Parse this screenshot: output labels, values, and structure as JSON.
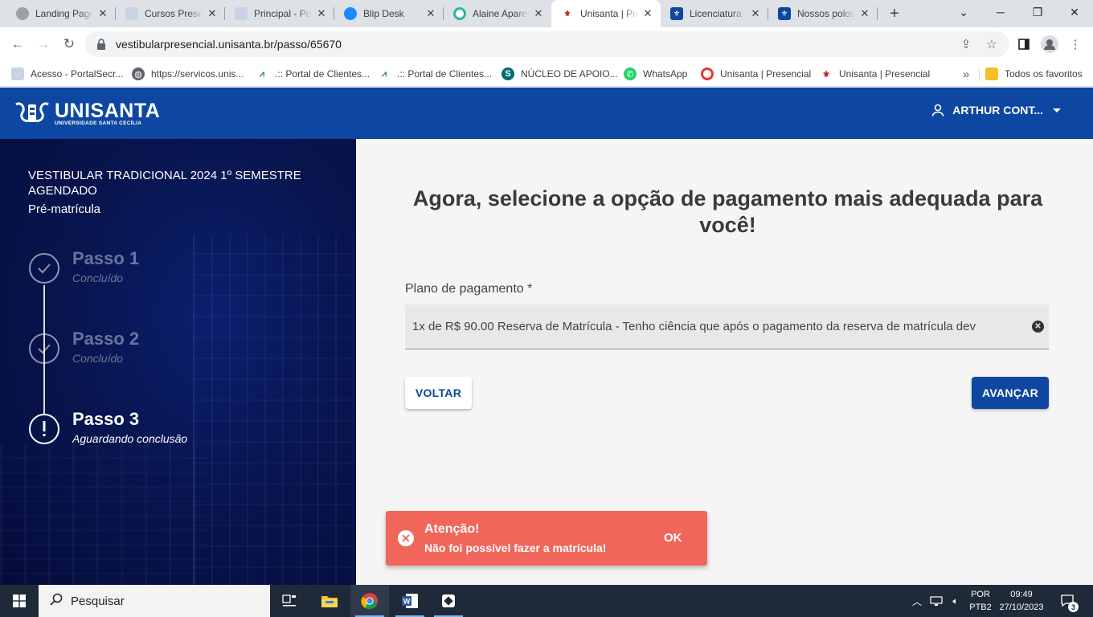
{
  "browser": {
    "tabs": [
      {
        "title": "Landing Page",
        "favicon": "doc-icon",
        "active": false
      },
      {
        "title": "Cursos Presenciais",
        "favicon": "doc-icon",
        "active": false
      },
      {
        "title": "Principal - Portal",
        "favicon": "doc-icon",
        "active": false
      },
      {
        "title": "Blip Desk",
        "favicon": "chat-bubble-icon",
        "active": false
      },
      {
        "title": "Alaine Aparecida",
        "favicon": "unisanta-ring-icon",
        "active": false
      },
      {
        "title": "Unisanta | Presencial",
        "favicon": "unisanta-logo-icon",
        "active": true
      },
      {
        "title": "Licenciatura",
        "favicon": "unisanta-blue-icon",
        "active": false
      },
      {
        "title": "Nossos polos",
        "favicon": "unisanta-blue-icon",
        "active": false
      }
    ],
    "url": "vestibularpresencial.unisanta.br/passo/65670",
    "bookmarks": [
      {
        "label": "Acesso - PortalSecr...",
        "icon": "doc-icon"
      },
      {
        "label": "https://servicos.unis...",
        "icon": "globe-icon"
      },
      {
        "label": ".:: Portal de Clientes...",
        "icon": "green-logo-icon"
      },
      {
        "label": ".:: Portal de Clientes...",
        "icon": "green-logo-icon"
      },
      {
        "label": "NÚCLEO DE APOIO...",
        "icon": "sharepoint-icon"
      },
      {
        "label": "WhatsApp",
        "icon": "whatsapp-icon"
      },
      {
        "label": "Unisanta | Presencial",
        "icon": "unisanta-ring-icon"
      },
      {
        "label": "Unisanta | Presencial",
        "icon": "unisanta-logo-icon"
      }
    ],
    "all_bookmarks_label": "Todos os favoritos"
  },
  "header": {
    "logo_text": "UNISANTA",
    "logo_subtext": "UNIVERSIDADE SANTA CECÍLIA",
    "user_name": "ARTHUR CONT..."
  },
  "sidebar": {
    "title": "VESTIBULAR TRADICIONAL 2024 1º SEMESTRE AGENDADO",
    "subtitle": "Pré-matrícula",
    "steps": [
      {
        "name": "Passo 1",
        "status": "Concluído",
        "state": "done"
      },
      {
        "name": "Passo 2",
        "status": "Concluído",
        "state": "done"
      },
      {
        "name": "Passo 3",
        "status": "Aguardando conclusão",
        "state": "current"
      }
    ]
  },
  "main": {
    "title": "Agora, selecione a opção de pagamento mais adequada para você!",
    "field_label": "Plano de pagamento *",
    "field_value": "1x de R$ 90.00 Reserva de Matrícula - Tenho ciência que após o pagamento da reserva de matrícula dev",
    "back_label": "VOLTAR",
    "next_label": "AVANÇAR"
  },
  "toast": {
    "title": "Atenção!",
    "message": "Não foi possível fazer a matrícula!",
    "ok_label": "OK"
  },
  "taskbar": {
    "search_placeholder": "Pesquisar",
    "lang_line1": "POR",
    "lang_line2": "PTB2",
    "time": "09:49",
    "date": "27/10/2023",
    "notification_count": "3"
  },
  "colors": {
    "brand_blue": "#0d47a1",
    "sidebar_navy": "#081550",
    "toast_red": "#f1665a"
  }
}
